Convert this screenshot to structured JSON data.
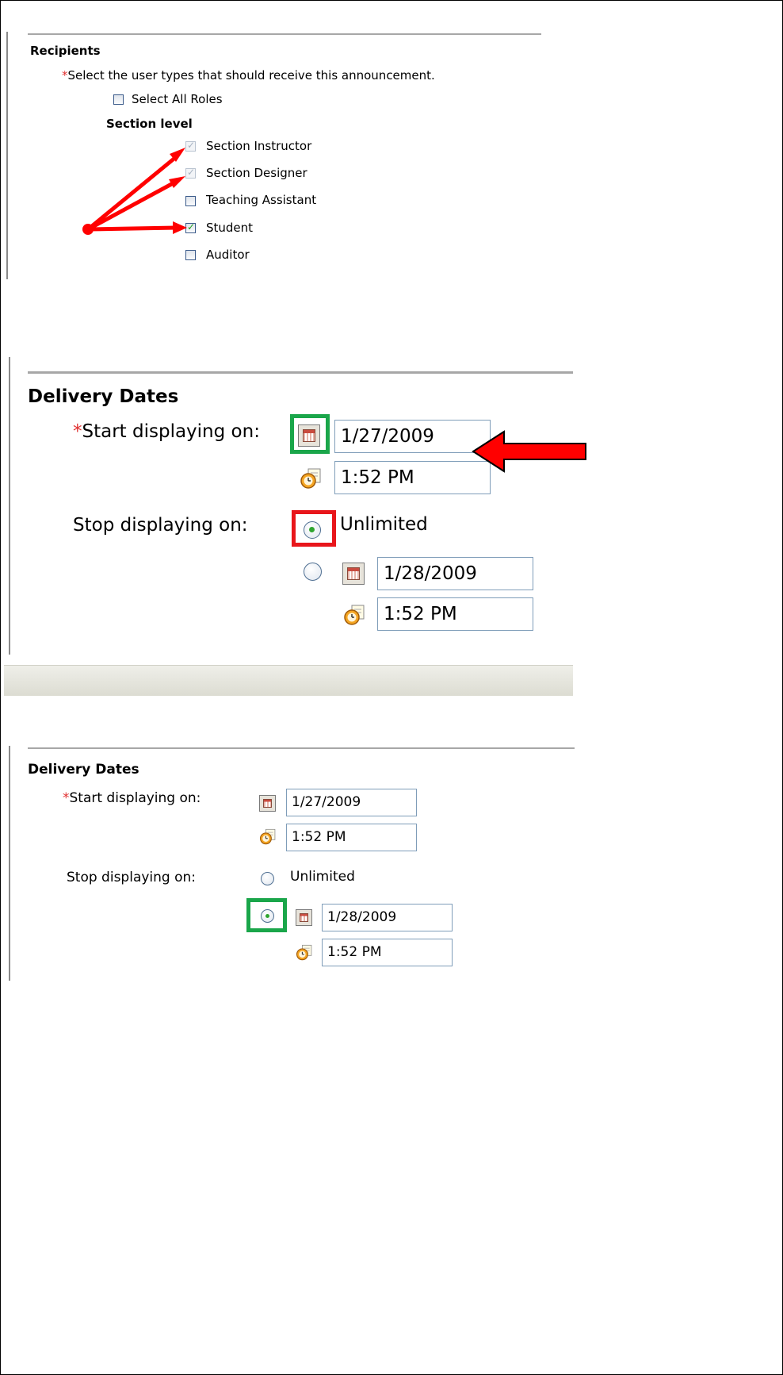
{
  "recipients": {
    "title": "Recipients",
    "required_marker": "*",
    "instruction": "Select the user types that should receive this announcement.",
    "select_all_label": "Select All Roles",
    "section_level_heading": "Section level",
    "roles": [
      {
        "label": "Section Instructor",
        "checked": true,
        "disabled": true
      },
      {
        "label": "Section Designer",
        "checked": true,
        "disabled": true
      },
      {
        "label": "Teaching Assistant",
        "checked": false,
        "disabled": false
      },
      {
        "label": "Student",
        "checked": true,
        "disabled": false
      },
      {
        "label": "Auditor",
        "checked": false,
        "disabled": false
      }
    ]
  },
  "delivery_large": {
    "title": "Delivery Dates",
    "required_marker": "*",
    "start_label": "Start displaying on:",
    "start_date": "1/27/2009",
    "start_time": "1:52 PM",
    "stop_label": "Stop displaying on:",
    "unlimited_label": "Unlimited",
    "stop_date": "1/28/2009",
    "stop_time": "1:52 PM",
    "selected_stop_option": "Unlimited"
  },
  "delivery_small": {
    "title": "Delivery Dates",
    "required_marker": "*",
    "start_label": "Start displaying on:",
    "start_date": "1/27/2009",
    "start_time": "1:52 PM",
    "stop_label": "Stop displaying on:",
    "unlimited_label": "Unlimited",
    "stop_date": "1/28/2009",
    "stop_time": "1:52 PM",
    "selected_stop_option": "date"
  },
  "icons": {
    "calendar": "calendar-icon",
    "clock": "clock-icon",
    "checkmark": "✓"
  },
  "colors": {
    "required": "#e03030",
    "highlight_green": "#1aa64a",
    "highlight_red": "#e8161b",
    "arrow_red": "#ff0000",
    "field_border": "#7f9db9"
  }
}
